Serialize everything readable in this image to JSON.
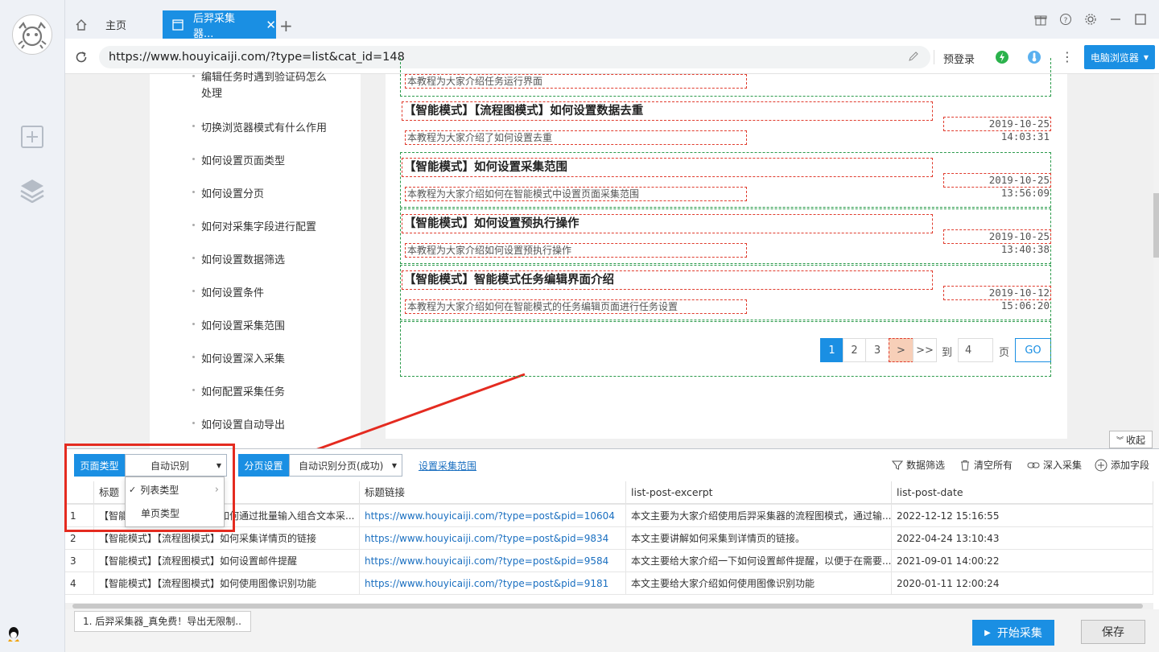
{
  "tabs": {
    "home": "主页",
    "active": "后羿采集器..."
  },
  "address": {
    "url": "https://www.houyicaiji.com/?type=list&cat_id=148",
    "prelogin": "预登录",
    "browser_mode": "电脑浏览器"
  },
  "sidebar": {
    "items": [
      "编辑任务时遇到验证码怎么处理",
      "切换浏览器模式有什么作用",
      "如何设置页面类型",
      "如何设置分页",
      "如何对采集字段进行配置",
      "如何设置数据筛选",
      "如何设置条件",
      "如何设置采集范围",
      "如何设置深入采集",
      "如何配置采集任务",
      "如何设置自动导出"
    ],
    "first_item_lines": [
      "编辑任务时遇到验证码怎么",
      "处理"
    ]
  },
  "posts": [
    {
      "title": "",
      "excerpt": "本教程为大家介绍任务运行界面",
      "date": ""
    },
    {
      "title": "【智能模式】【流程图模式】如何设置数据去重",
      "excerpt": "本教程为大家介绍了如何设置去重",
      "date": "2019-10-25 14:03:31"
    },
    {
      "title": "【智能模式】如何设置采集范围",
      "excerpt": "本教程为大家介绍如何在智能模式中设置页面采集范围",
      "date": "2019-10-25 13:56:09"
    },
    {
      "title": "【智能模式】如何设置预执行操作",
      "excerpt": "本教程为大家介绍如何设置预执行操作",
      "date": "2019-10-25 13:40:38"
    },
    {
      "title": "【智能模式】智能模式任务编辑界面介绍",
      "excerpt": "本教程为大家介绍如何在智能模式的任务编辑页面进行任务设置",
      "date": "2019-10-12 15:06:20"
    }
  ],
  "pagination": {
    "pages": [
      "1",
      "2",
      "3"
    ],
    "next": ">",
    "last": ">>",
    "goto_label": "到",
    "goto_value": "4",
    "page_label": "页",
    "go": "GO"
  },
  "panel": {
    "collapse": "收起",
    "page_type_label": "页面类型",
    "page_type_value": "自动识别",
    "paging_label": "分页设置",
    "paging_value": "自动识别分页(成功)",
    "range_link": "设置采集范围",
    "tools": [
      "数据筛选",
      "清空所有",
      "深入采集",
      "添加字段"
    ],
    "dropdown": [
      "列表类型",
      "单页类型"
    ]
  },
  "table": {
    "headers": [
      "标题",
      "标题链接",
      "list-post-excerpt",
      "list-post-date"
    ],
    "rows": [
      {
        "n": "1",
        "title": "【智能模式】【流程图模式】如何通过批量输入组合文本采...",
        "link": "https://www.houyicaiji.com/?type=post&pid=10604",
        "excerpt": "本文主要为大家介绍使用后羿采集器的流程图模式，通过输...",
        "date": "2022-12-12 15:16:55"
      },
      {
        "n": "2",
        "title": "【智能模式】【流程图模式】如何采集详情页的链接",
        "link": "https://www.houyicaiji.com/?type=post&pid=9834",
        "excerpt": "本文主要讲解如何采集到详情页的链接。",
        "date": "2022-04-24 13:10:43"
      },
      {
        "n": "3",
        "title": "【智能模式】【流程图模式】如何设置邮件提醒",
        "link": "https://www.houyicaiji.com/?type=post&pid=9584",
        "excerpt": "本文主要给大家介绍一下如何设置邮件提醒，以便于在需要...",
        "date": "2021-09-01 14:00:22"
      },
      {
        "n": "4",
        "title": "【智能模式】【流程图模式】如何使用图像识别功能",
        "link": "https://www.houyicaiji.com/?type=post&pid=9181",
        "excerpt": "本文主要给大家介绍如何使用图像识别功能",
        "date": "2020-01-11 12:00:24"
      }
    ]
  },
  "footer": {
    "task": "1. 后羿采集器_真免费！导出无限制..",
    "start": "开始采集",
    "save": "保存"
  },
  "colors": {
    "accent": "#1a8fe3",
    "annotation": "#e42b20",
    "dashed_green": "#2a9a4a"
  }
}
